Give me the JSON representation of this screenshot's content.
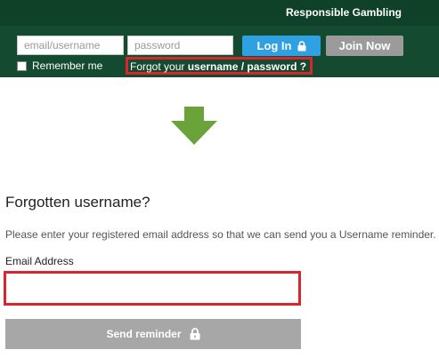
{
  "header": {
    "responsible_gambling": "Responsible Gambling",
    "username_placeholder": "email/username",
    "password_placeholder": "password",
    "login_label": "Log In",
    "join_label": "Join Now",
    "remember_label": "Remember me",
    "forgot_prefix": "Forgot your ",
    "forgot_link": "username / password ?"
  },
  "main": {
    "title": "Forgotten username?",
    "description": "Please enter your registered email address so that we can send you a Username reminder.",
    "email_label": "Email Address",
    "email_value": "",
    "send_label": "Send reminder"
  },
  "colors": {
    "header_bg": "#134a30",
    "login_blue": "#2fa0e2",
    "join_gray": "#9b9b9b",
    "highlight_red": "#d7262e",
    "arrow_green": "#6aa33a",
    "send_gray": "#a7a7a7"
  },
  "icons": [
    "lock-icon",
    "down-arrow-icon"
  ]
}
